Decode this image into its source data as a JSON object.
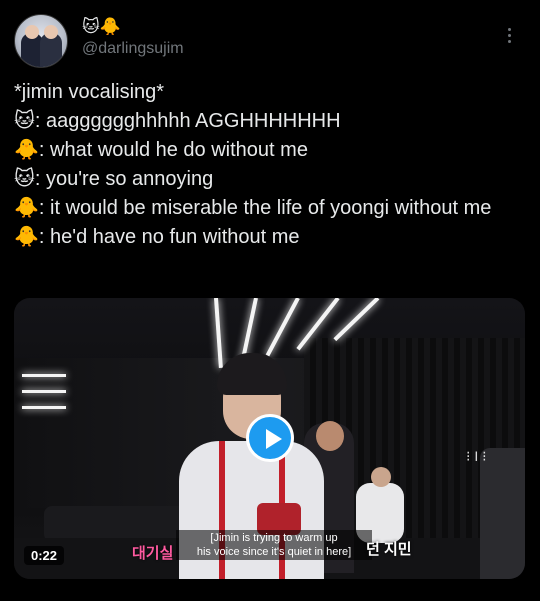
{
  "user": {
    "display_name": "🐱🐥",
    "handle": "@darlingsujim",
    "avatar_icon": "avatar-image"
  },
  "tweet": {
    "lines": [
      "*jimin vocalising*",
      "🐱: aagggggghhhhh AGGHHHHHHH",
      "🐥: what would he do without me",
      "🐱: you're so annoying",
      "🐥: it would be miserable the life of yoongi without me",
      "🐥: he'd have no fun without me"
    ]
  },
  "video": {
    "duration": "0:22",
    "subtitle_line1": "[Jimin is trying to warm up",
    "subtitle_line2": "his voice since it's quiet in here]",
    "caption_left": "대기실",
    "caption_right": "던 지민",
    "play_icon": "play-icon",
    "accent_color": "#1d9bf0"
  }
}
